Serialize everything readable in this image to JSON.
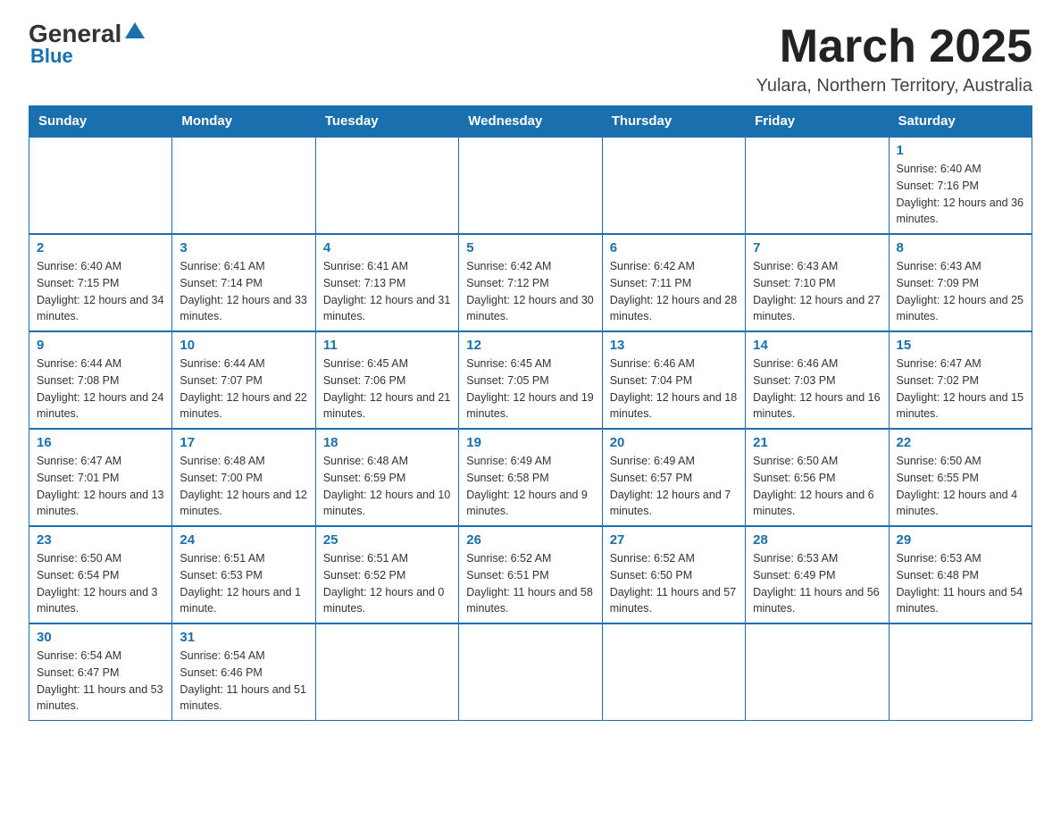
{
  "logo": {
    "general": "General",
    "blue": "Blue"
  },
  "title": "March 2025",
  "location": "Yulara, Northern Territory, Australia",
  "weekdays": [
    "Sunday",
    "Monday",
    "Tuesday",
    "Wednesday",
    "Thursday",
    "Friday",
    "Saturday"
  ],
  "weeks": [
    [
      null,
      null,
      null,
      null,
      null,
      null,
      {
        "day": "1",
        "sunrise": "Sunrise: 6:40 AM",
        "sunset": "Sunset: 7:16 PM",
        "daylight": "Daylight: 12 hours and 36 minutes."
      }
    ],
    [
      {
        "day": "2",
        "sunrise": "Sunrise: 6:40 AM",
        "sunset": "Sunset: 7:15 PM",
        "daylight": "Daylight: 12 hours and 34 minutes."
      },
      {
        "day": "3",
        "sunrise": "Sunrise: 6:41 AM",
        "sunset": "Sunset: 7:14 PM",
        "daylight": "Daylight: 12 hours and 33 minutes."
      },
      {
        "day": "4",
        "sunrise": "Sunrise: 6:41 AM",
        "sunset": "Sunset: 7:13 PM",
        "daylight": "Daylight: 12 hours and 31 minutes."
      },
      {
        "day": "5",
        "sunrise": "Sunrise: 6:42 AM",
        "sunset": "Sunset: 7:12 PM",
        "daylight": "Daylight: 12 hours and 30 minutes."
      },
      {
        "day": "6",
        "sunrise": "Sunrise: 6:42 AM",
        "sunset": "Sunset: 7:11 PM",
        "daylight": "Daylight: 12 hours and 28 minutes."
      },
      {
        "day": "7",
        "sunrise": "Sunrise: 6:43 AM",
        "sunset": "Sunset: 7:10 PM",
        "daylight": "Daylight: 12 hours and 27 minutes."
      },
      {
        "day": "8",
        "sunrise": "Sunrise: 6:43 AM",
        "sunset": "Sunset: 7:09 PM",
        "daylight": "Daylight: 12 hours and 25 minutes."
      }
    ],
    [
      {
        "day": "9",
        "sunrise": "Sunrise: 6:44 AM",
        "sunset": "Sunset: 7:08 PM",
        "daylight": "Daylight: 12 hours and 24 minutes."
      },
      {
        "day": "10",
        "sunrise": "Sunrise: 6:44 AM",
        "sunset": "Sunset: 7:07 PM",
        "daylight": "Daylight: 12 hours and 22 minutes."
      },
      {
        "day": "11",
        "sunrise": "Sunrise: 6:45 AM",
        "sunset": "Sunset: 7:06 PM",
        "daylight": "Daylight: 12 hours and 21 minutes."
      },
      {
        "day": "12",
        "sunrise": "Sunrise: 6:45 AM",
        "sunset": "Sunset: 7:05 PM",
        "daylight": "Daylight: 12 hours and 19 minutes."
      },
      {
        "day": "13",
        "sunrise": "Sunrise: 6:46 AM",
        "sunset": "Sunset: 7:04 PM",
        "daylight": "Daylight: 12 hours and 18 minutes."
      },
      {
        "day": "14",
        "sunrise": "Sunrise: 6:46 AM",
        "sunset": "Sunset: 7:03 PM",
        "daylight": "Daylight: 12 hours and 16 minutes."
      },
      {
        "day": "15",
        "sunrise": "Sunrise: 6:47 AM",
        "sunset": "Sunset: 7:02 PM",
        "daylight": "Daylight: 12 hours and 15 minutes."
      }
    ],
    [
      {
        "day": "16",
        "sunrise": "Sunrise: 6:47 AM",
        "sunset": "Sunset: 7:01 PM",
        "daylight": "Daylight: 12 hours and 13 minutes."
      },
      {
        "day": "17",
        "sunrise": "Sunrise: 6:48 AM",
        "sunset": "Sunset: 7:00 PM",
        "daylight": "Daylight: 12 hours and 12 minutes."
      },
      {
        "day": "18",
        "sunrise": "Sunrise: 6:48 AM",
        "sunset": "Sunset: 6:59 PM",
        "daylight": "Daylight: 12 hours and 10 minutes."
      },
      {
        "day": "19",
        "sunrise": "Sunrise: 6:49 AM",
        "sunset": "Sunset: 6:58 PM",
        "daylight": "Daylight: 12 hours and 9 minutes."
      },
      {
        "day": "20",
        "sunrise": "Sunrise: 6:49 AM",
        "sunset": "Sunset: 6:57 PM",
        "daylight": "Daylight: 12 hours and 7 minutes."
      },
      {
        "day": "21",
        "sunrise": "Sunrise: 6:50 AM",
        "sunset": "Sunset: 6:56 PM",
        "daylight": "Daylight: 12 hours and 6 minutes."
      },
      {
        "day": "22",
        "sunrise": "Sunrise: 6:50 AM",
        "sunset": "Sunset: 6:55 PM",
        "daylight": "Daylight: 12 hours and 4 minutes."
      }
    ],
    [
      {
        "day": "23",
        "sunrise": "Sunrise: 6:50 AM",
        "sunset": "Sunset: 6:54 PM",
        "daylight": "Daylight: 12 hours and 3 minutes."
      },
      {
        "day": "24",
        "sunrise": "Sunrise: 6:51 AM",
        "sunset": "Sunset: 6:53 PM",
        "daylight": "Daylight: 12 hours and 1 minute."
      },
      {
        "day": "25",
        "sunrise": "Sunrise: 6:51 AM",
        "sunset": "Sunset: 6:52 PM",
        "daylight": "Daylight: 12 hours and 0 minutes."
      },
      {
        "day": "26",
        "sunrise": "Sunrise: 6:52 AM",
        "sunset": "Sunset: 6:51 PM",
        "daylight": "Daylight: 11 hours and 58 minutes."
      },
      {
        "day": "27",
        "sunrise": "Sunrise: 6:52 AM",
        "sunset": "Sunset: 6:50 PM",
        "daylight": "Daylight: 11 hours and 57 minutes."
      },
      {
        "day": "28",
        "sunrise": "Sunrise: 6:53 AM",
        "sunset": "Sunset: 6:49 PM",
        "daylight": "Daylight: 11 hours and 56 minutes."
      },
      {
        "day": "29",
        "sunrise": "Sunrise: 6:53 AM",
        "sunset": "Sunset: 6:48 PM",
        "daylight": "Daylight: 11 hours and 54 minutes."
      }
    ],
    [
      {
        "day": "30",
        "sunrise": "Sunrise: 6:54 AM",
        "sunset": "Sunset: 6:47 PM",
        "daylight": "Daylight: 11 hours and 53 minutes."
      },
      {
        "day": "31",
        "sunrise": "Sunrise: 6:54 AM",
        "sunset": "Sunset: 6:46 PM",
        "daylight": "Daylight: 11 hours and 51 minutes."
      },
      null,
      null,
      null,
      null,
      null
    ]
  ]
}
